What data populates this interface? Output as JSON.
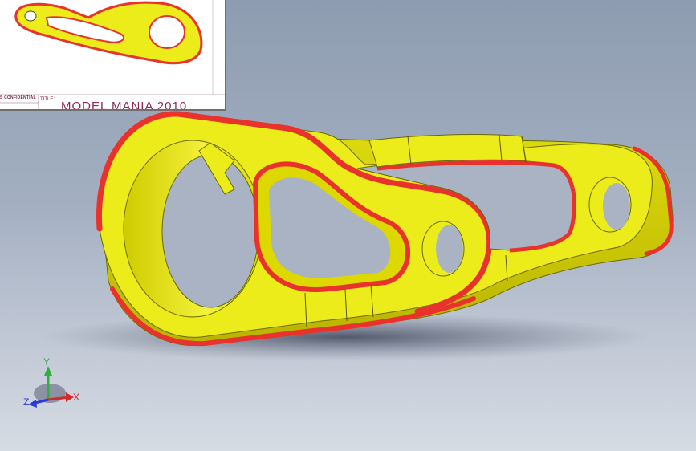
{
  "preview": {
    "confidential_text": "S CONFIDENTIAL",
    "title_label": "TITLE:",
    "title_text": "MODEL MANIA 2010"
  },
  "triad": {
    "x_label": "X",
    "y_label": "Y",
    "z_label": "Z"
  },
  "colors": {
    "part_face": "#ecec1a",
    "part_side": "#d4d000",
    "fillet_highlight": "#e8322b",
    "background_top": "#8e9cb1",
    "background_bottom": "#d6dce4",
    "axis_x": "#d42a2a",
    "axis_y": "#2bb03a",
    "axis_z": "#2a3ad4"
  },
  "icons": {
    "triad": "reference-triad-icon",
    "preview": "drawing-preview-thumbnail"
  }
}
